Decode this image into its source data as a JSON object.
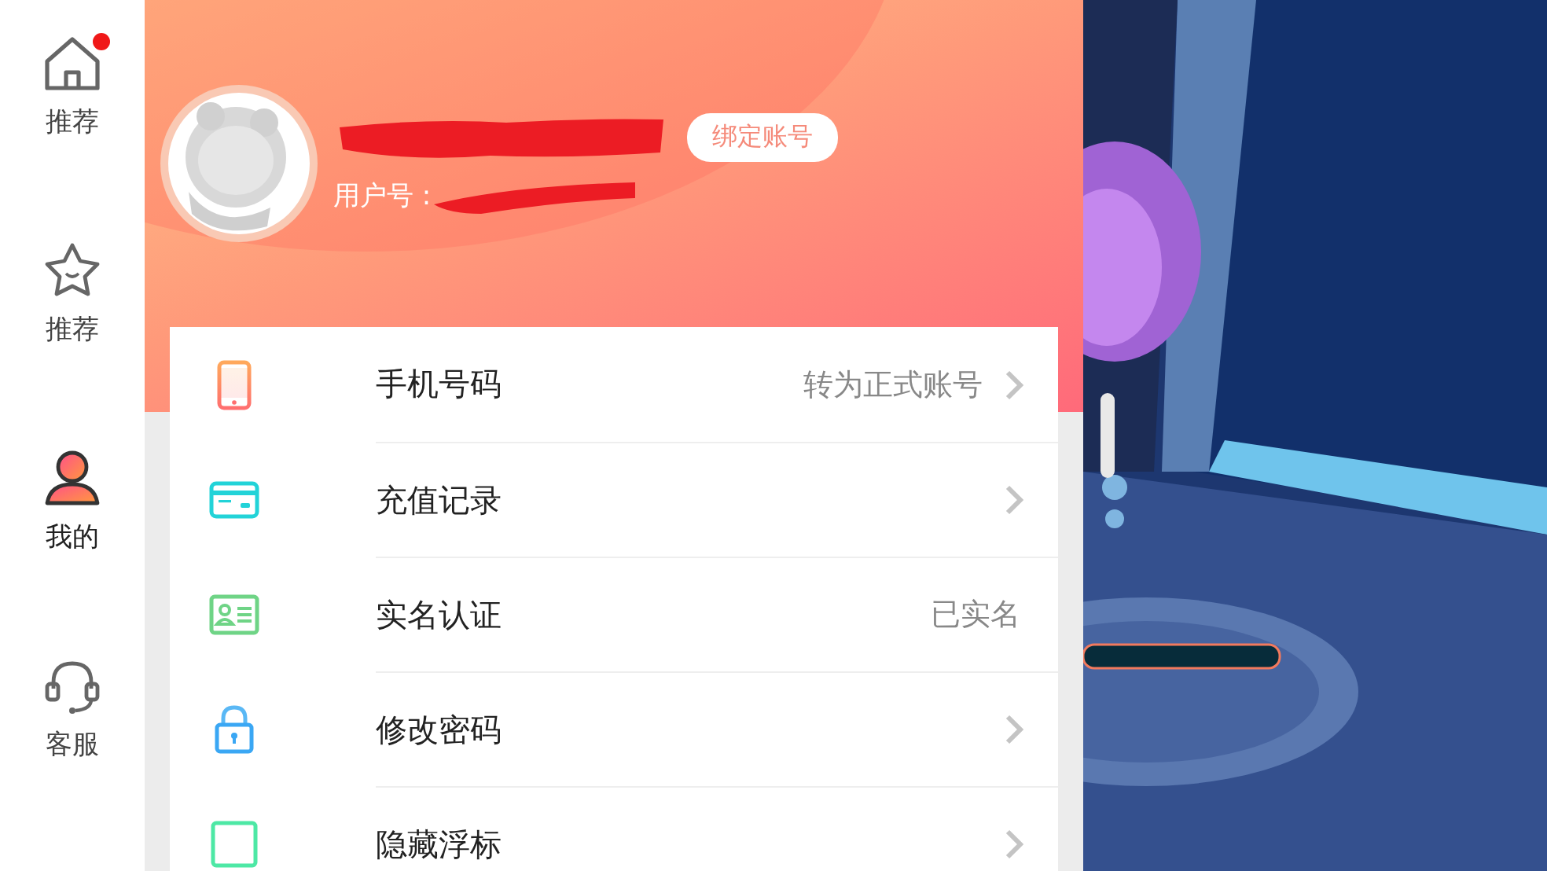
{
  "nav": [
    {
      "label": "推荐",
      "badge": true,
      "selected": false
    },
    {
      "label": "推荐",
      "badge": false,
      "selected": false
    },
    {
      "label": "我的",
      "badge": false,
      "selected": true
    },
    {
      "label": "客服",
      "badge": false,
      "selected": false
    }
  ],
  "profile": {
    "user_id_label": "用户号 :",
    "bind_button": "绑定账号"
  },
  "settings": [
    {
      "label": "手机号码",
      "value": "转为正式账号",
      "chevron": true
    },
    {
      "label": "充值记录",
      "chevron": true
    },
    {
      "label": "实名认证",
      "value": "已实名",
      "chevron": false
    },
    {
      "label": "修改密码",
      "chevron": true
    },
    {
      "label": "隐藏浮标",
      "chevron": true
    }
  ]
}
